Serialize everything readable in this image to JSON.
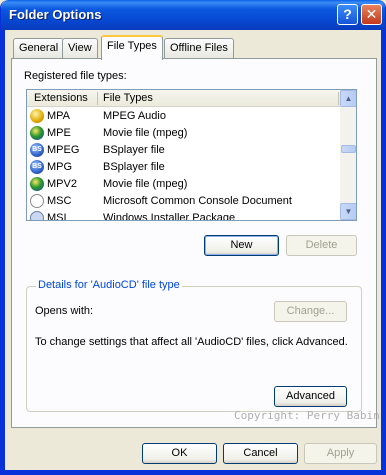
{
  "window": {
    "title": "Folder Options"
  },
  "tabs": [
    {
      "label": "General"
    },
    {
      "label": "View"
    },
    {
      "label": "File Types"
    },
    {
      "label": "Offline Files"
    }
  ],
  "file_types": {
    "list_label": "Registered file types:",
    "columns": [
      "Extensions",
      "File Types"
    ],
    "rows": [
      {
        "ext": "MPA",
        "type": "MPEG Audio",
        "icon": "audio-icon"
      },
      {
        "ext": "MPE",
        "type": "Movie file (mpeg)",
        "icon": "movie-icon"
      },
      {
        "ext": "MPEG",
        "type": "BSplayer file",
        "icon": "bsplayer-icon"
      },
      {
        "ext": "MPG",
        "type": "BSplayer file",
        "icon": "bsplayer-icon"
      },
      {
        "ext": "MPV2",
        "type": "Movie file (mpeg)",
        "icon": "movie-icon"
      },
      {
        "ext": "MSC",
        "type": "Microsoft Common Console Document",
        "icon": "console-icon"
      },
      {
        "ext": "MSI",
        "type": "Windows Installer Package",
        "icon": "installer-icon"
      }
    ],
    "new_label": "New",
    "delete_label": "Delete"
  },
  "details": {
    "title": "Details for 'AudioCD' file type",
    "opens_with_label": "Opens with:",
    "change_label": "Change...",
    "description": "To change settings that affect all 'AudioCD' files, click Advanced.",
    "advanced_label": "Advanced"
  },
  "watermark": "Copyright: Perry Babin",
  "footer": {
    "ok_label": "OK",
    "cancel_label": "Cancel",
    "apply_label": "Apply"
  },
  "colors": {
    "titlebar": "#0b59e0",
    "group_title": "#0046d5",
    "face": "#ece9d8"
  }
}
